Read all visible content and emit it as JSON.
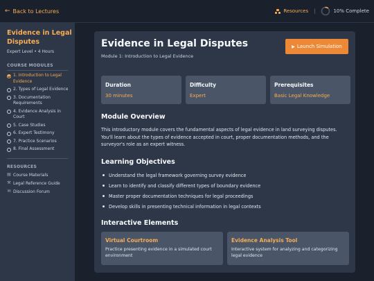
{
  "topbar": {
    "back_label": "Back to Lectures",
    "resources_label": "Resources",
    "separator": "|",
    "progress_label": "10% Complete",
    "progress_fraction": 0.1
  },
  "sidebar": {
    "course_title": "Evidence in Legal Disputes",
    "course_meta": "Expert Level • 4 Hours",
    "modules_heading": "COURSE MODULES",
    "modules": [
      {
        "label": "1. Introduction to Legal Evidence",
        "active": true
      },
      {
        "label": "2. Types of Legal Evidence",
        "active": false
      },
      {
        "label": "3. Documentation Requirements",
        "active": false
      },
      {
        "label": "4. Evidence Analysis in Court",
        "active": false
      },
      {
        "label": "5. Case Studies",
        "active": false
      },
      {
        "label": "6. Expert Testimony",
        "active": false
      },
      {
        "label": "7. Practice Scenarios",
        "active": false
      },
      {
        "label": "8. Final Assessment",
        "active": false
      }
    ],
    "resources_heading": "RESOURCES",
    "resources": [
      {
        "label": "Course Materials",
        "icon": "document-icon"
      },
      {
        "label": "Legal Reference Guide",
        "icon": "gavel-icon"
      },
      {
        "label": "Discussion Forum",
        "icon": "chat-icon"
      }
    ]
  },
  "main": {
    "title": "Evidence in Legal Disputes",
    "subtitle": "Module 1: Introduction to Legal Evidence",
    "launch_label": "Launch Simulation",
    "stats": [
      {
        "label": "Duration",
        "value": "30 minutes"
      },
      {
        "label": "Difficulty",
        "value": "Expert"
      },
      {
        "label": "Prerequisites",
        "value": "Basic Legal Knowledge"
      }
    ],
    "overview_heading": "Module Overview",
    "overview_text": "This introductory module covers the fundamental aspects of legal evidence in land surveying disputes. You'll learn about the types of evidence accepted in court, proper documentation methods, and the surveyor's role as an expert witness.",
    "objectives_heading": "Learning Objectives",
    "objectives": [
      "Understand the legal framework governing survey evidence",
      "Learn to identify and classify different types of boundary evidence",
      "Master proper documentation techniques for legal proceedings",
      "Develop skills in presenting technical information in legal contexts"
    ],
    "interactive_heading": "Interactive Elements",
    "interactive": [
      {
        "title": "Virtual Courtroom",
        "desc": "Practice presenting evidence in a simulated court environment"
      },
      {
        "title": "Evidence Analysis Tool",
        "desc": "Interactive system for analyzing and categorizing legal evidence"
      }
    ]
  },
  "colors": {
    "accent": "#f6ad55",
    "button": "#ed8936",
    "background": "#1a202c",
    "panel": "#2d3748",
    "card": "#4a5568"
  }
}
